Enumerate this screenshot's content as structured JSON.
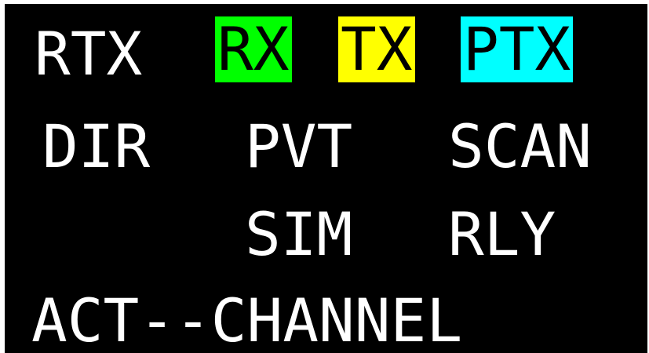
{
  "display": {
    "row1": {
      "rtx": "RTX",
      "rx": "RX",
      "tx": "TX",
      "ptx": "PTX"
    },
    "row2": {
      "dir": "DIR",
      "pvt": "PVT",
      "scan": "SCAN"
    },
    "row3": {
      "sim": "SIM",
      "rly": "RLY"
    },
    "row4": {
      "channel": "ACT--CHANNEL"
    }
  },
  "colors": {
    "background": "#000000",
    "text": "#ffffff",
    "rx_highlight": "#00ff00",
    "tx_highlight": "#ffff00",
    "ptx_highlight": "#00ffff"
  }
}
